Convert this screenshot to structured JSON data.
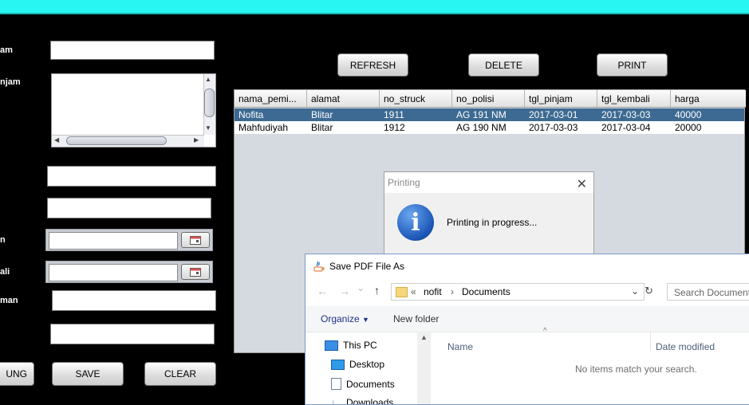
{
  "form": {
    "labels": [
      "am",
      "njam",
      "n",
      "ali",
      "man"
    ],
    "buttons": {
      "left_partial": "UNG",
      "save": "SAVE",
      "clear": "CLEAR"
    }
  },
  "toolbar": {
    "refresh": "REFRESH",
    "delete": "DELETE",
    "print": "PRINT"
  },
  "table": {
    "columns": [
      "nama_pemi...",
      "alamat",
      "no_struck",
      "no_polisi",
      "tgl_pinjam",
      "tgl_kembali",
      "harga"
    ],
    "rows": [
      [
        "Nofita",
        "Blitar",
        "1911",
        "AG 191 NM",
        "2017-03-01",
        "2017-03-03",
        "40000"
      ],
      [
        "Mahfudiyah",
        "Blitar",
        "1912",
        "AG 190 NM",
        "2017-03-03",
        "2017-03-04",
        "20000"
      ]
    ],
    "selected_row": 0
  },
  "printing_dialog": {
    "title": "Printing",
    "message": "Printing in progress...",
    "icon": "info-icon"
  },
  "save_dialog": {
    "title": "Save PDF File As",
    "path": {
      "overflow": "«",
      "segments": [
        "nofit",
        "Documents"
      ]
    },
    "search_placeholder": "Search Documents",
    "commands": {
      "organize": "Organize",
      "new_folder": "New folder"
    },
    "nav_items": [
      "This PC",
      "Desktop",
      "Documents",
      "Downloads"
    ],
    "columns": {
      "name": "Name",
      "date_modified": "Date modified"
    },
    "empty_message": "No items match your search."
  },
  "colors": {
    "top_bar": "#27f6f3",
    "selected_row": "#3d6a92",
    "background": "#000000"
  }
}
